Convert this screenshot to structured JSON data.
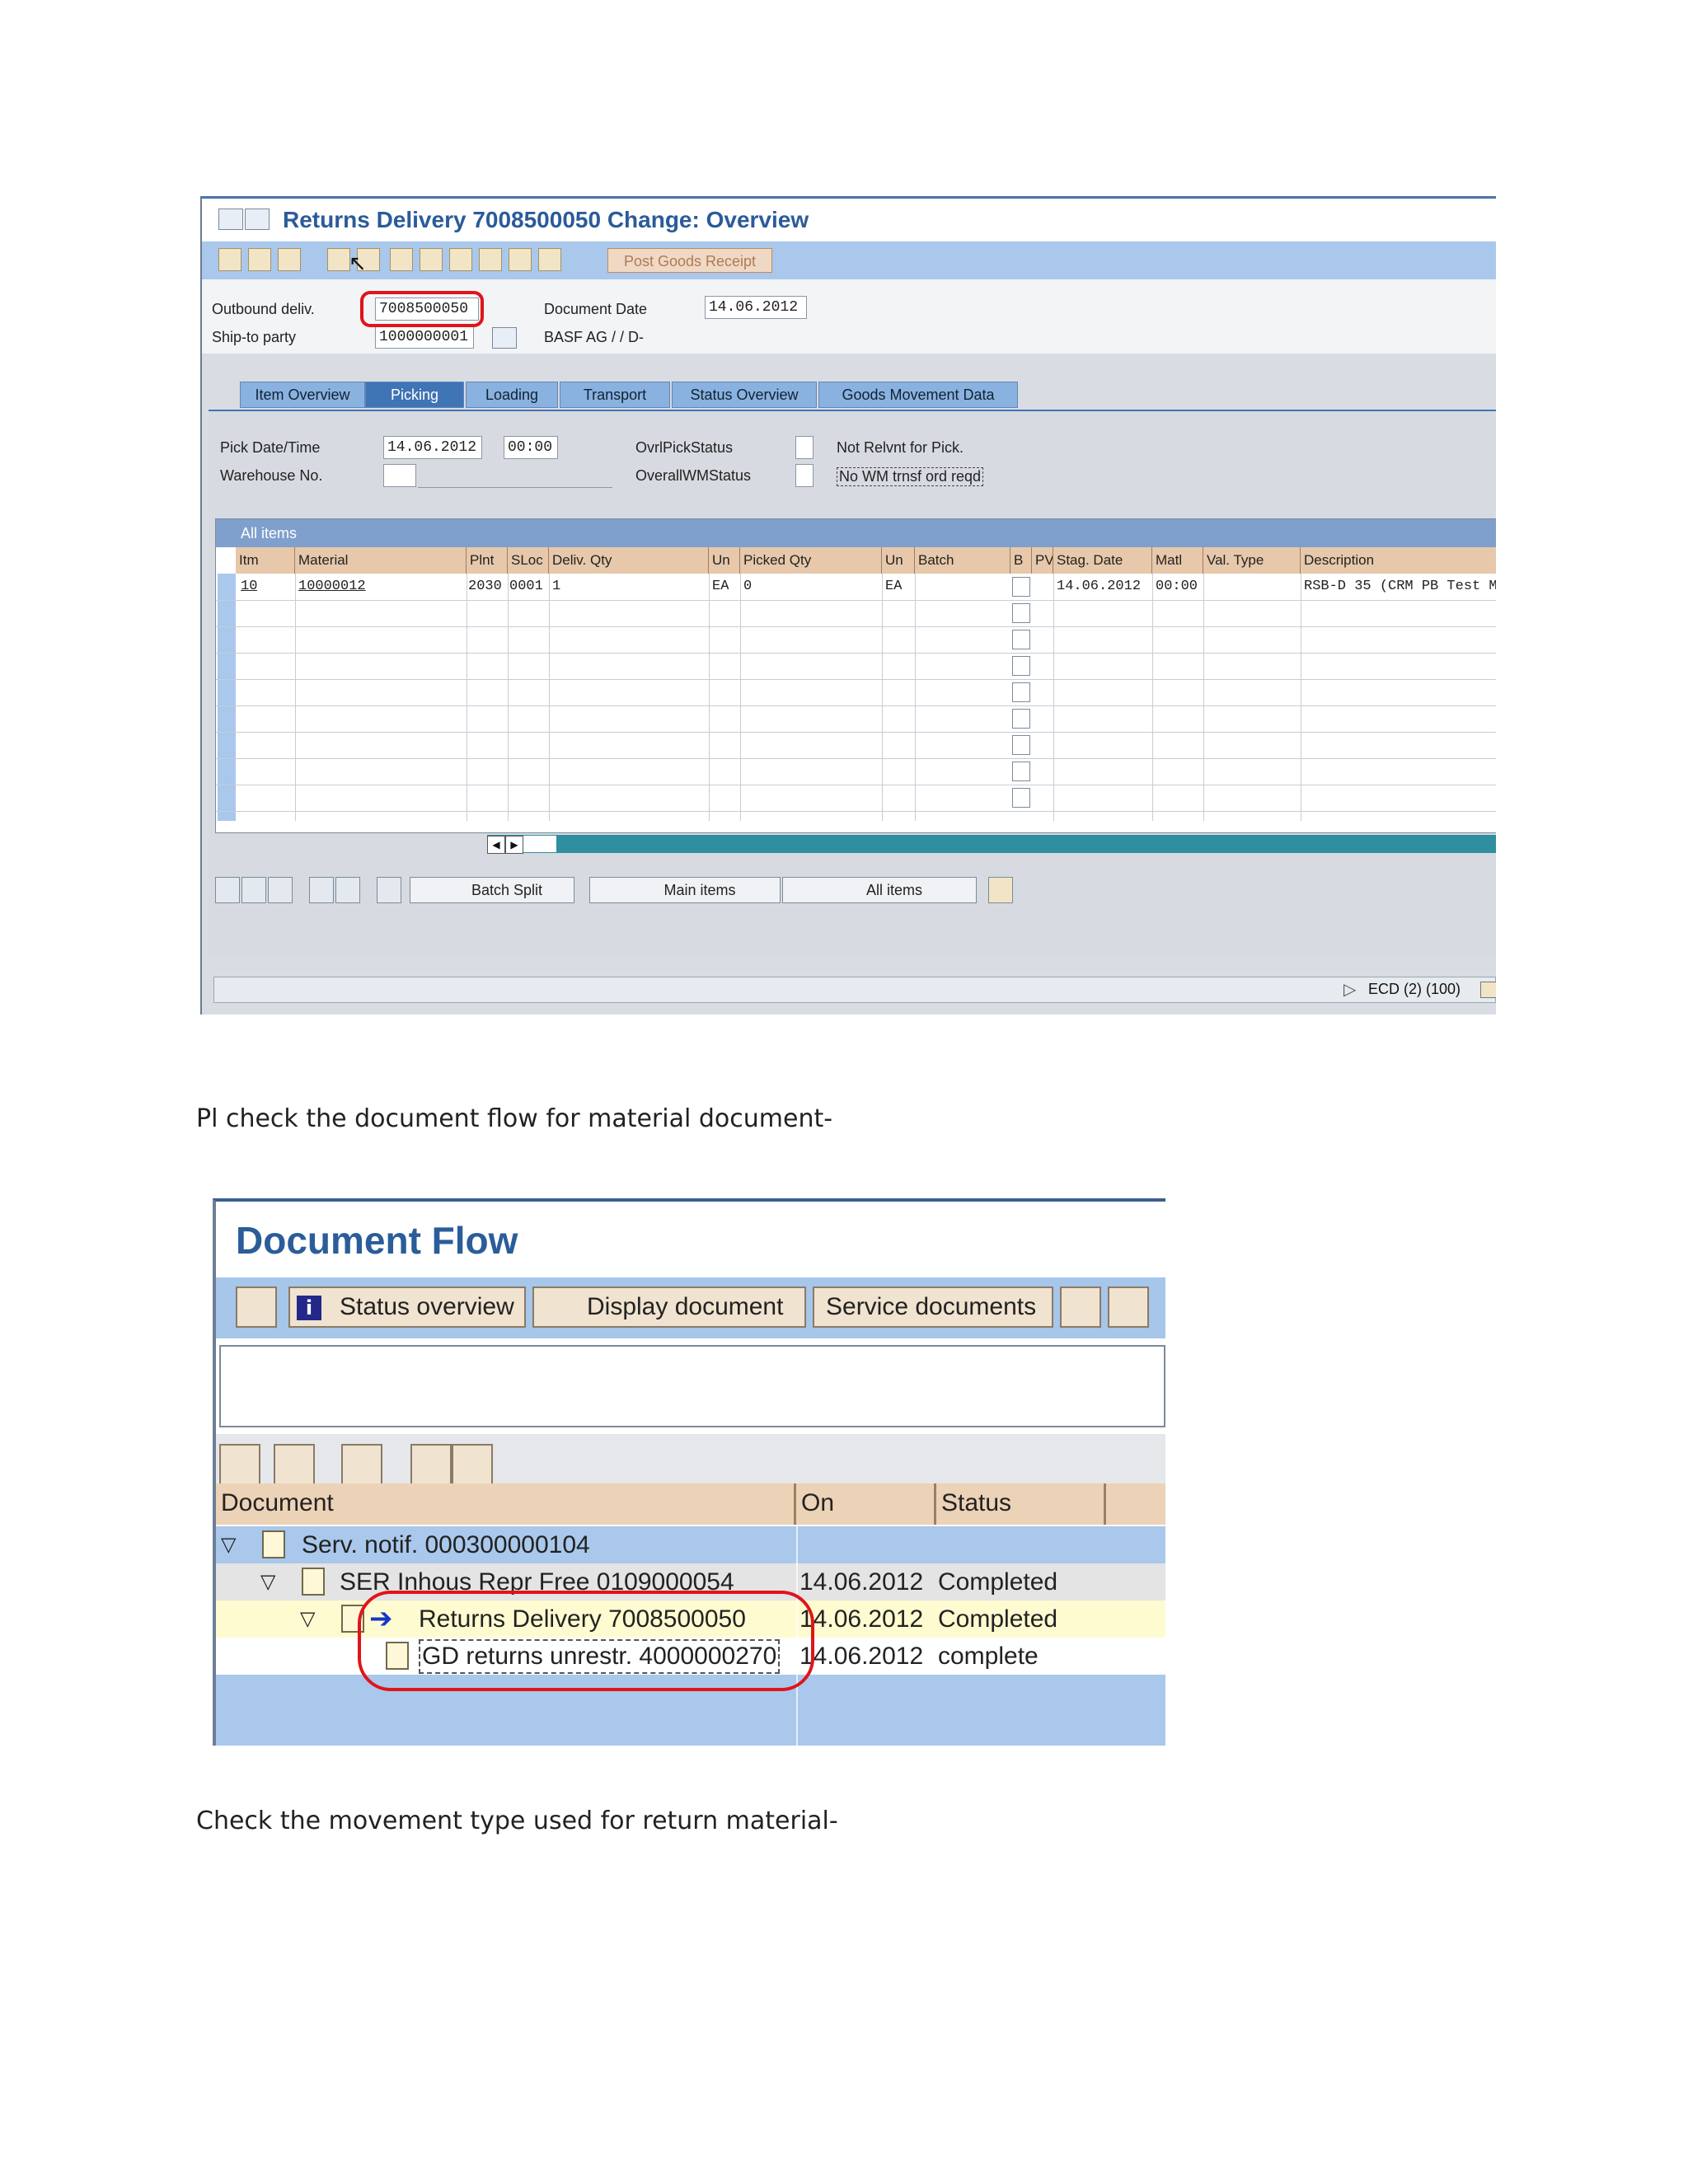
{
  "screenshot1": {
    "title": "Returns Delivery 7008500050 Change: Overview",
    "post_goods_receipt_label": "Post Goods Receipt",
    "header": {
      "outbound_deliv_label": "Outbound deliv.",
      "outbound_deliv_value": "7008500050",
      "document_date_label": "Document Date",
      "document_date_value": "14.06.2012",
      "ship_to_party_label": "Ship-to party",
      "ship_to_party_value": "1000000001",
      "ship_to_party_name": "BASF AG / / D-"
    },
    "tabs": [
      "Item Overview",
      "Picking",
      "Loading",
      "Transport",
      "Status Overview",
      "Goods Movement Data"
    ],
    "active_tab": "Picking",
    "picking": {
      "pick_date_time_label": "Pick Date/Time",
      "pick_date_value": "14.06.2012",
      "pick_time_value": "00:00",
      "warehouse_no_label": "Warehouse No.",
      "ovrl_pick_status_label": "OvrlPickStatus",
      "ovrl_pick_status_text": "Not Relvnt for Pick.",
      "overall_wm_status_label": "OverallWMStatus",
      "overall_wm_status_text": "No WM trnsf ord reqd"
    },
    "grid": {
      "title": "All items",
      "columns": [
        "Itm",
        "Material",
        "Plnt",
        "SLoc",
        "Deliv. Qty",
        "Un",
        "Picked Qty",
        "Un",
        "Batch",
        "B",
        "PV",
        "Stag. Date",
        "Matl",
        "Val. Type",
        "Description"
      ],
      "rows": [
        {
          "itm": "10",
          "material": "10000012",
          "plnt": "2030",
          "sloc": "0001",
          "deliv_qty": "1",
          "un": "EA",
          "picked_qty": "0",
          "un2": "EA",
          "stag_date": "14.06.2012",
          "matl": "00:00",
          "description": "RSB-D 35 (CRM PB Test M"
        }
      ]
    },
    "bottom_buttons": {
      "batch_split": "Batch Split",
      "main_items": "Main items",
      "all_items": "All items"
    },
    "status_bar": "ECD (2) (100)"
  },
  "paragraph1": "Pl check the document flow for material document-",
  "screenshot2": {
    "title": "Document Flow",
    "buttons": {
      "status_overview": "Status overview",
      "display_document": "Display document",
      "service_documents": "Service documents"
    },
    "columns": [
      "Document",
      "On",
      "Status"
    ],
    "rows": [
      {
        "document": "Serv. notif. 000300000104",
        "on": "",
        "status": ""
      },
      {
        "document": "SER Inhous Repr Free 0109000054",
        "on": "14.06.2012",
        "status": "Completed"
      },
      {
        "document": "Returns Delivery 7008500050",
        "on": "14.06.2012",
        "status": "Completed"
      },
      {
        "document": "GD returns unrestr. 4000000270",
        "on": "14.06.2012",
        "status": "complete"
      }
    ]
  },
  "paragraph2": "Check the movement type used for return material-"
}
